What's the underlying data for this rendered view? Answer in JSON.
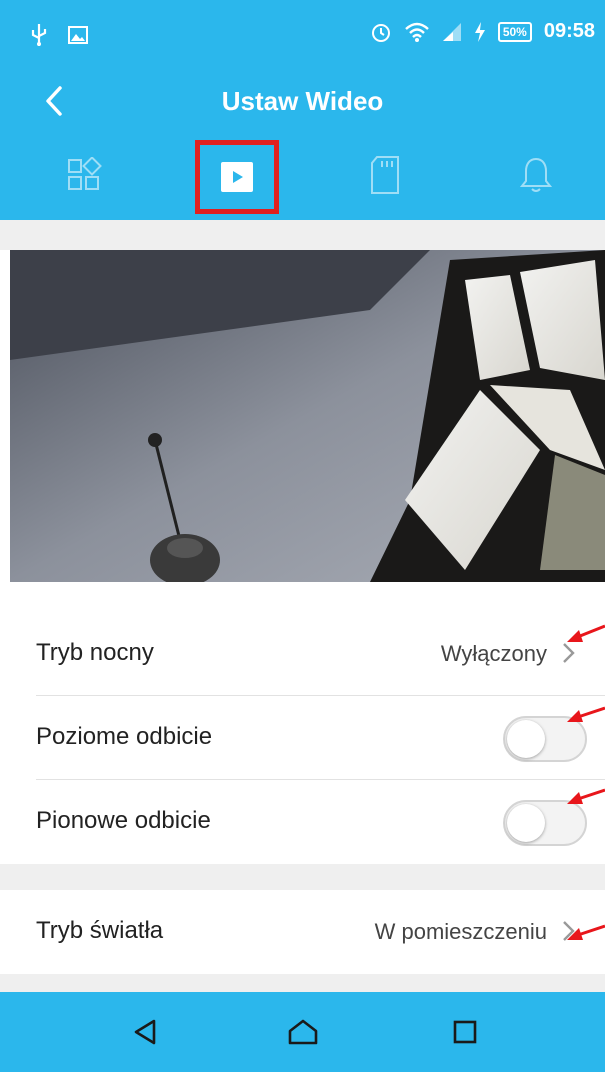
{
  "status_bar": {
    "battery_percent": "50%",
    "time": "09:58",
    "icons": [
      "usb-icon",
      "image-icon",
      "alarm-icon",
      "wifi-icon",
      "signal-icon",
      "charging-icon"
    ]
  },
  "header": {
    "title": "Ustaw Wideo",
    "back_icon": "chevron-left-icon"
  },
  "tabs": [
    {
      "icon": "grid-apps-icon",
      "active": false
    },
    {
      "icon": "video-play-icon",
      "active": true
    },
    {
      "icon": "sd-card-icon",
      "active": false
    },
    {
      "icon": "bell-icon",
      "active": false
    }
  ],
  "settings": {
    "night_mode": {
      "label": "Tryb nocny",
      "value": "Wyłączony"
    },
    "horizontal_flip": {
      "label": "Poziome odbicie",
      "enabled": false
    },
    "vertical_flip": {
      "label": "Pionowe odbicie",
      "enabled": false
    },
    "light_mode": {
      "label": "Tryb światła",
      "value": "W pomieszczeniu"
    }
  },
  "colors": {
    "accent": "#2bb7ec",
    "highlight_box": "#e02020",
    "annotation_arrow": "#e8161b",
    "section_gap": "#efefef"
  },
  "nav_bar": {
    "icons": [
      "back-triangle-icon",
      "home-icon",
      "recents-icon"
    ]
  }
}
